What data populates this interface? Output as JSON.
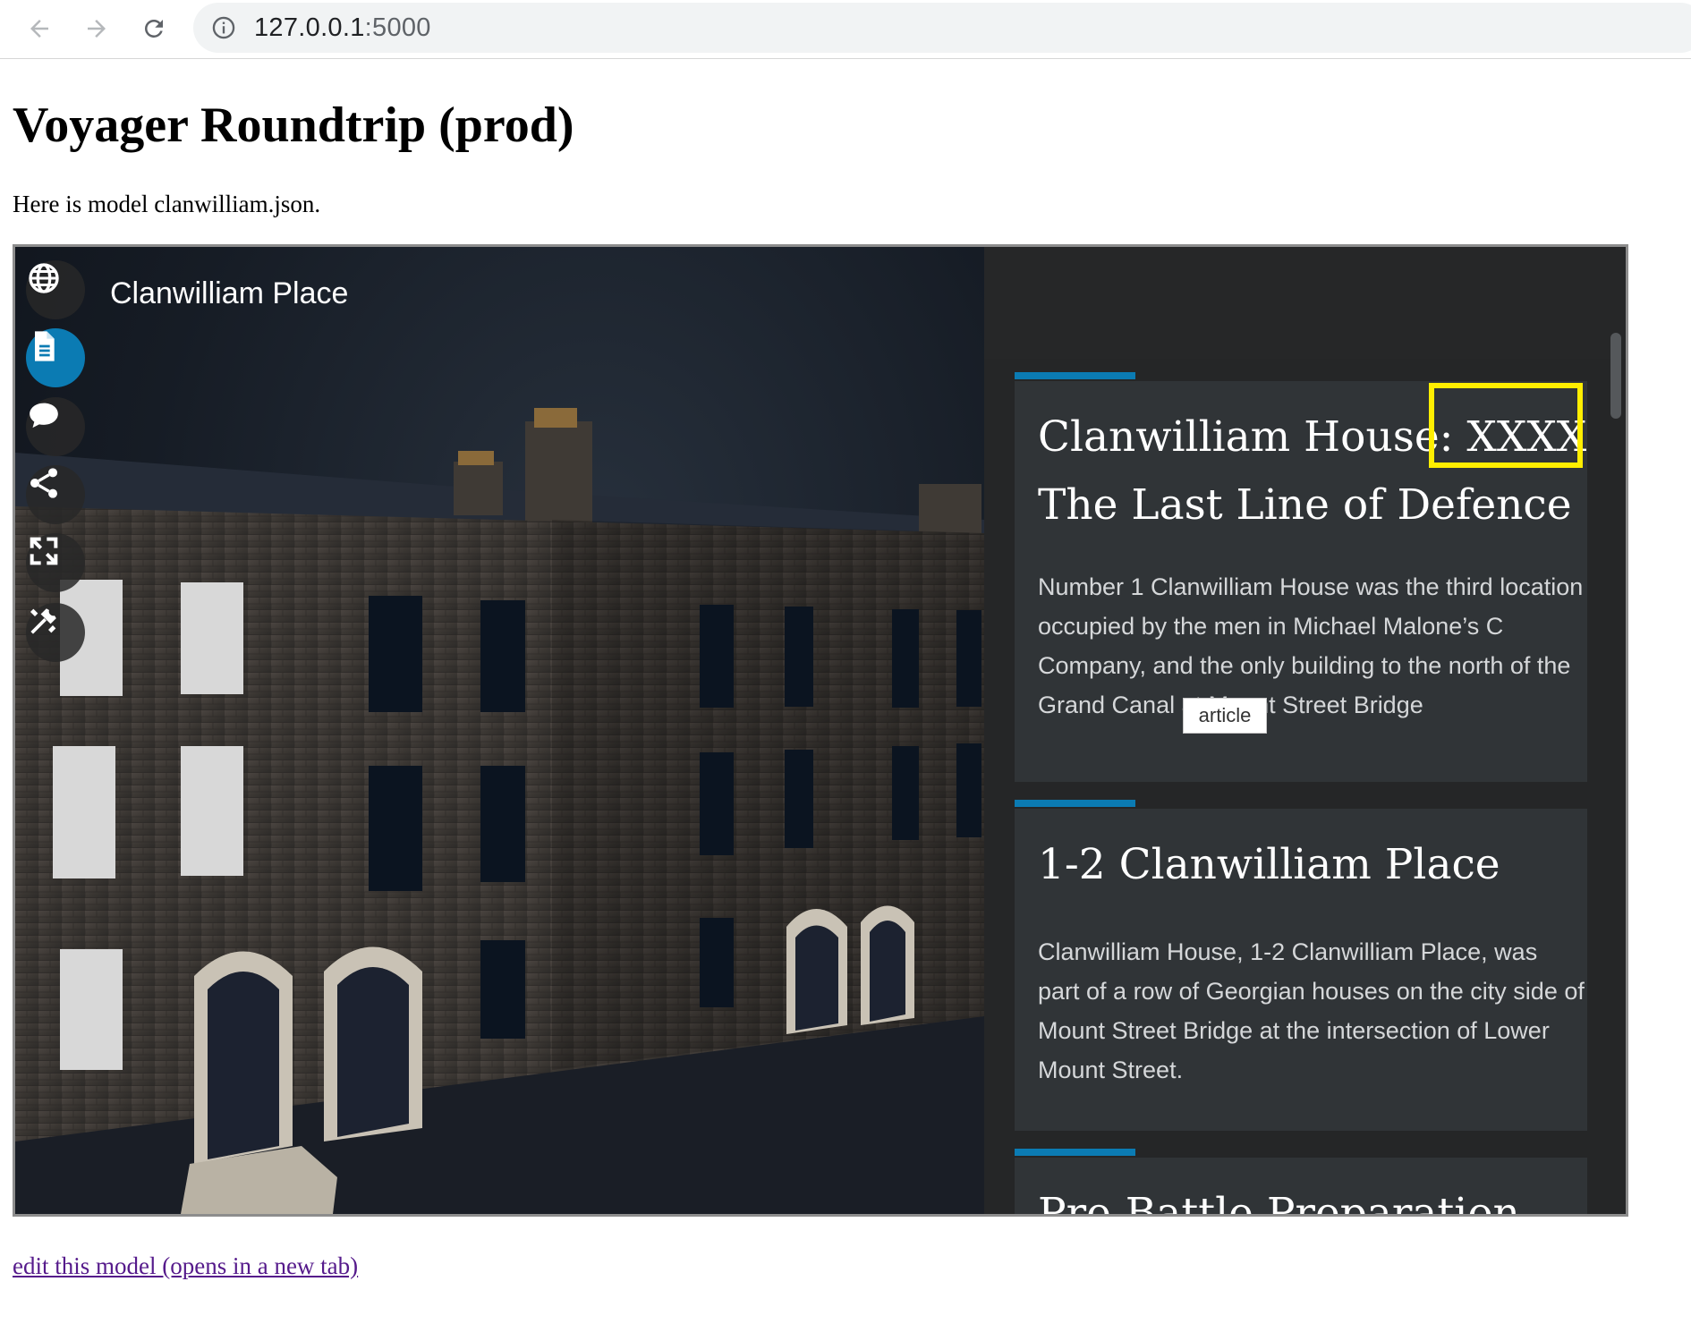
{
  "browser": {
    "url_host": "127.0.0.1",
    "url_port": ":5000"
  },
  "page": {
    "title": "Voyager Roundtrip (prod)",
    "intro": "Here is model clanwilliam.json.",
    "edit_link": "edit this model (opens in a new tab)"
  },
  "viewer": {
    "scene_title": "Clanwilliam Place",
    "toolbar": [
      "globe-icon",
      "document-icon",
      "comment-icon",
      "share-icon",
      "expand-icon",
      "tools-icon"
    ],
    "active_tool": "document-icon",
    "accent_color": "#0b7bb3",
    "articles": [
      {
        "title_line1": "Clanwilliam House: XXXX",
        "title_line2": "The Last Line of Defence",
        "body": "Number 1 Clanwilliam House was the third location occupied by the men in Michael Malone’s C Company, and the only building to the north of the Grand Canal at Mount Street Bridge"
      },
      {
        "title_line1": "1-2 Clanwilliam Place",
        "body": "Clanwilliam House, 1-2 Clanwilliam Place, was part of a row of Georgian houses on the city side of Mount Street Bridge at the intersection of Lower Mount Street."
      },
      {
        "title_line1": "Pre-Battle Preparation"
      }
    ],
    "tooltip": "article",
    "highlight_color": "#ffee00"
  }
}
